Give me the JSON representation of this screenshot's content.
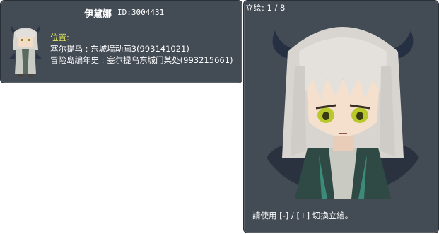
{
  "npc": {
    "name": "伊黛娜",
    "id_label": "ID:3004431"
  },
  "location": {
    "label": "位置:",
    "lines": [
      "塞尔提乌 : 东城墙动画3(993141021)",
      "冒险岛编年史 : 塞尔提乌东城门某处(993215661)"
    ]
  },
  "portrait": {
    "counter": "立绘: 1 / 8",
    "hint": "請使用 [-] / [+] 切換立繪。"
  },
  "colors": {
    "panel_bg": "#434b55",
    "label_yellow": "#e8ea5a",
    "hair": "#d9d6d2",
    "horn": "#2c3547",
    "eyes": "#b9c92c"
  },
  "icons": [
    "npc-thumbnail-icon",
    "npc-portrait-art"
  ]
}
